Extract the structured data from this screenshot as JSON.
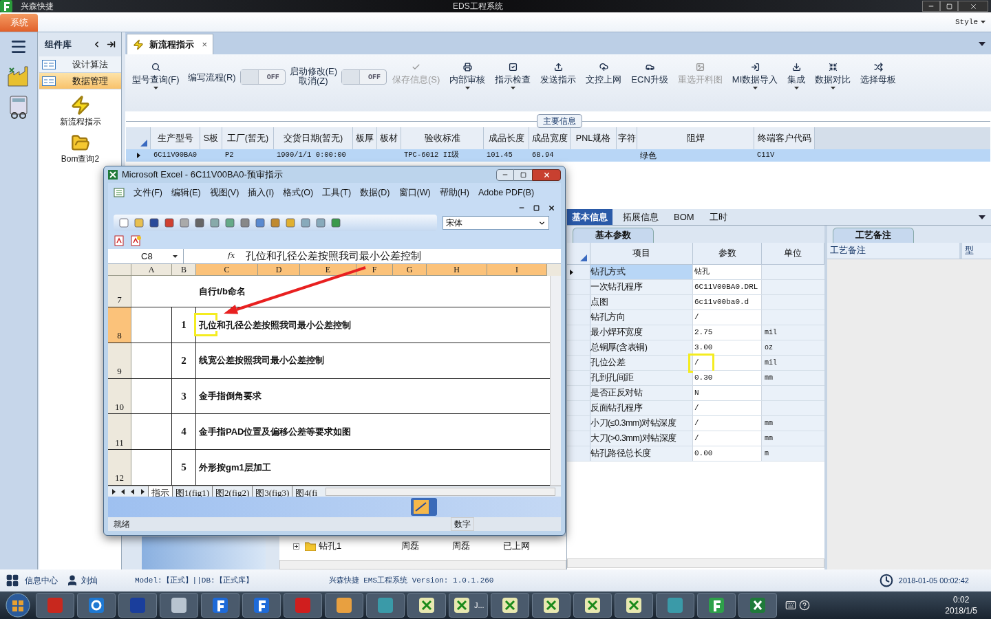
{
  "titlebar": {
    "app": "兴森快捷",
    "title": "EDS工程系统"
  },
  "menubar": {
    "system_tab": "系统",
    "style": "Style"
  },
  "sidebar": {
    "title": "组件库",
    "groups": [
      {
        "label": "设计算法",
        "selected": false
      },
      {
        "label": "数据管理",
        "selected": true
      }
    ],
    "items": [
      {
        "label": "新流程指示",
        "kind": "bolt"
      },
      {
        "label": "Bom查询2",
        "kind": "folder"
      }
    ]
  },
  "doc_tab": {
    "label": "新流程指示",
    "close": "×"
  },
  "toolbar": [
    {
      "kind": "button",
      "label": "型号查询(F)",
      "dropdown": true,
      "disabled": false
    },
    {
      "kind": "text",
      "label": "编写流程(R)"
    },
    {
      "kind": "toggle",
      "label": "OFF",
      "on": false
    },
    {
      "kind": "text2",
      "label": "启动修改(E)",
      "label2": "取消(Z)"
    },
    {
      "kind": "toggle",
      "label": "OFF",
      "on": false
    },
    {
      "kind": "button",
      "label": "保存信息(S)",
      "dropdown": false,
      "disabled": true
    },
    {
      "kind": "button",
      "label": "内部审核",
      "dropdown": true,
      "disabled": false
    },
    {
      "kind": "button",
      "label": "指示检查",
      "dropdown": true,
      "disabled": false
    },
    {
      "kind": "button",
      "label": "发送指示",
      "dropdown": false,
      "disabled": false
    },
    {
      "kind": "button",
      "label": "文控上网",
      "dropdown": false,
      "disabled": false
    },
    {
      "kind": "button",
      "label": "ECN升级",
      "dropdown": false,
      "disabled": false
    },
    {
      "kind": "button",
      "label": "重选开料图",
      "dropdown": false,
      "disabled": true
    },
    {
      "kind": "button",
      "label": "MI数据导入",
      "dropdown": true,
      "disabled": false
    },
    {
      "kind": "button",
      "label": "集成",
      "dropdown": true,
      "disabled": false
    },
    {
      "kind": "button",
      "label": "数据对比",
      "dropdown": true,
      "disabled": false
    },
    {
      "kind": "button",
      "label": "选择母板",
      "dropdown": false,
      "disabled": false
    }
  ],
  "main_info": {
    "legend": "主要信息",
    "columns": [
      "生产型号",
      "S板",
      "工厂(暂无)",
      "交货日期(暂无)",
      "板厚",
      "板材",
      "验收标准",
      "成品长度",
      "成品宽度",
      "PNL规格",
      "字符",
      "阻焊",
      "终端客户代码"
    ],
    "rows": [
      {
        "selected": true,
        "cells": [
          "6C11V00BA0",
          null,
          "P2",
          "1900/1/1 0:00:00",
          null,
          null,
          "TPC-6012 II级",
          "101.45",
          "68.94",
          null,
          null,
          "绿色",
          "C11V"
        ]
      }
    ]
  },
  "detail_tabs": [
    {
      "label": "基本信息",
      "selected": true
    },
    {
      "label": "拓展信息",
      "selected": false
    },
    {
      "label": "BOM",
      "selected": false
    },
    {
      "label": "工时",
      "selected": false
    }
  ],
  "params": {
    "tab": "基本参数",
    "columns": [
      "项目",
      "参数",
      "单位"
    ],
    "rows": [
      {
        "item": "钻孔方式",
        "value": "钻孔",
        "unit": null,
        "selected": true,
        "marked": false
      },
      {
        "item": "一次钻孔程序",
        "value": "6C11V00BA0.DRL",
        "unit": null,
        "selected": false,
        "marked": false
      },
      {
        "item": "点图",
        "value": "6c11v00ba0.d",
        "unit": null,
        "selected": false,
        "marked": false
      },
      {
        "item": "钻孔方向",
        "value": "/",
        "unit": null,
        "selected": false,
        "marked": false
      },
      {
        "item": "最小焊环宽度",
        "value": "2.75",
        "unit": "mil",
        "selected": false,
        "marked": false
      },
      {
        "item": "总铜厚(含表铜)",
        "value": "3.00",
        "unit": "oz",
        "selected": false,
        "marked": false
      },
      {
        "item": "孔位公差",
        "value": "/",
        "unit": "mil",
        "selected": false,
        "marked": true
      },
      {
        "item": "孔到孔间距",
        "value": "0.30",
        "unit": "mm",
        "selected": false,
        "marked": false
      },
      {
        "item": "是否正反对钻",
        "value": "N",
        "unit": null,
        "selected": false,
        "marked": false
      },
      {
        "item": "反面钻孔程序",
        "value": "/",
        "unit": null,
        "selected": false,
        "marked": false
      },
      {
        "item": "小刀(≤0.3mm)对钻深度",
        "value": "/",
        "unit": "mm",
        "selected": false,
        "marked": false
      },
      {
        "item": "大刀(>0.3mm)对钻深度",
        "value": "/",
        "unit": "mm",
        "selected": false,
        "marked": false
      },
      {
        "item": "钻孔路径总长度",
        "value": "0.00",
        "unit": "m",
        "selected": false,
        "marked": false
      }
    ]
  },
  "remarks": {
    "tab": "工艺备注",
    "columns": [
      "工艺备注",
      "型"
    ]
  },
  "tree": {
    "rows": [
      {
        "label": "钻孔1",
        "expanded": false,
        "cells": [
          "周磊",
          "周磊",
          "已上网"
        ]
      }
    ]
  },
  "excel": {
    "title": "Microsoft Excel - 6C11V00BA0-预审指示",
    "menu": [
      "文件(F)",
      "编辑(E)",
      "视图(V)",
      "插入(I)",
      "格式(O)",
      "工具(T)",
      "数据(D)",
      "窗口(W)",
      "帮助(H)",
      "Adobe PDF(B)"
    ],
    "font": "宋体",
    "name_box": "C8",
    "fx": "fx",
    "formula": "孔位和孔径公差按照我司最小公差控制",
    "columns": [
      {
        "label": "A",
        "selected": false
      },
      {
        "label": "B",
        "selected": false
      },
      {
        "label": "C",
        "selected": true
      },
      {
        "label": "D",
        "selected": true
      },
      {
        "label": "E",
        "selected": true
      },
      {
        "label": "F",
        "selected": true
      },
      {
        "label": "G",
        "selected": true
      },
      {
        "label": "H",
        "selected": true
      },
      {
        "label": "I",
        "selected": true
      }
    ],
    "rows": [
      {
        "num": "7",
        "text": "自行t/b命名",
        "selected": false,
        "marked": false
      },
      {
        "num": "8",
        "index": "1",
        "text": "孔位和孔径公差按照我司最小公差控制",
        "selected": true,
        "marked": true
      },
      {
        "num": "9",
        "index": "2",
        "text": "线宽公差按照我司最小公差控制",
        "selected": false,
        "marked": false
      },
      {
        "num": "10",
        "index": "3",
        "text": "金手指倒角要求",
        "selected": false,
        "marked": false
      },
      {
        "num": "11",
        "index": "4",
        "text": "金手指PAD位置及偏移公差等要求如图",
        "selected": false,
        "marked": false
      },
      {
        "num": "12",
        "index": "5",
        "text": "外形按gm1层加工",
        "selected": false,
        "marked": false
      }
    ],
    "sheets": [
      {
        "label": "指示",
        "selected": true
      },
      {
        "label": "图1(fig1)",
        "selected": false
      },
      {
        "label": "图2(fig2)",
        "selected": false
      },
      {
        "label": "图3(fig3)",
        "selected": false
      },
      {
        "label": "图4(fi",
        "selected": false
      }
    ],
    "status": "就绪",
    "num_indicator": "数字"
  },
  "statusbar": {
    "info": "信息中心",
    "user": "刘灿",
    "model": "Model:【正式】||DB:【正式库】",
    "product": "兴森快捷 EMS工程系统 Version: 1.0.1.260",
    "datetime": "2018-01-05 00:02:42"
  },
  "taskbar": {
    "items": [
      {
        "kind": "red"
      },
      {
        "kind": "ie"
      },
      {
        "kind": "disk"
      },
      {
        "kind": "scanner"
      },
      {
        "kind": "fblue"
      },
      {
        "kind": "fblue"
      },
      {
        "kind": "pdf"
      },
      {
        "kind": "shell"
      },
      {
        "kind": "ufo"
      },
      {
        "kind": "xls"
      },
      {
        "kind": "xls",
        "label": "J..."
      },
      {
        "kind": "xls"
      },
      {
        "kind": "xls"
      },
      {
        "kind": "xls"
      },
      {
        "kind": "xls"
      },
      {
        "kind": "ufo"
      },
      {
        "kind": "fgreen"
      },
      {
        "kind": "excel"
      }
    ],
    "time": "0:02",
    "date": "2018/1/5"
  }
}
